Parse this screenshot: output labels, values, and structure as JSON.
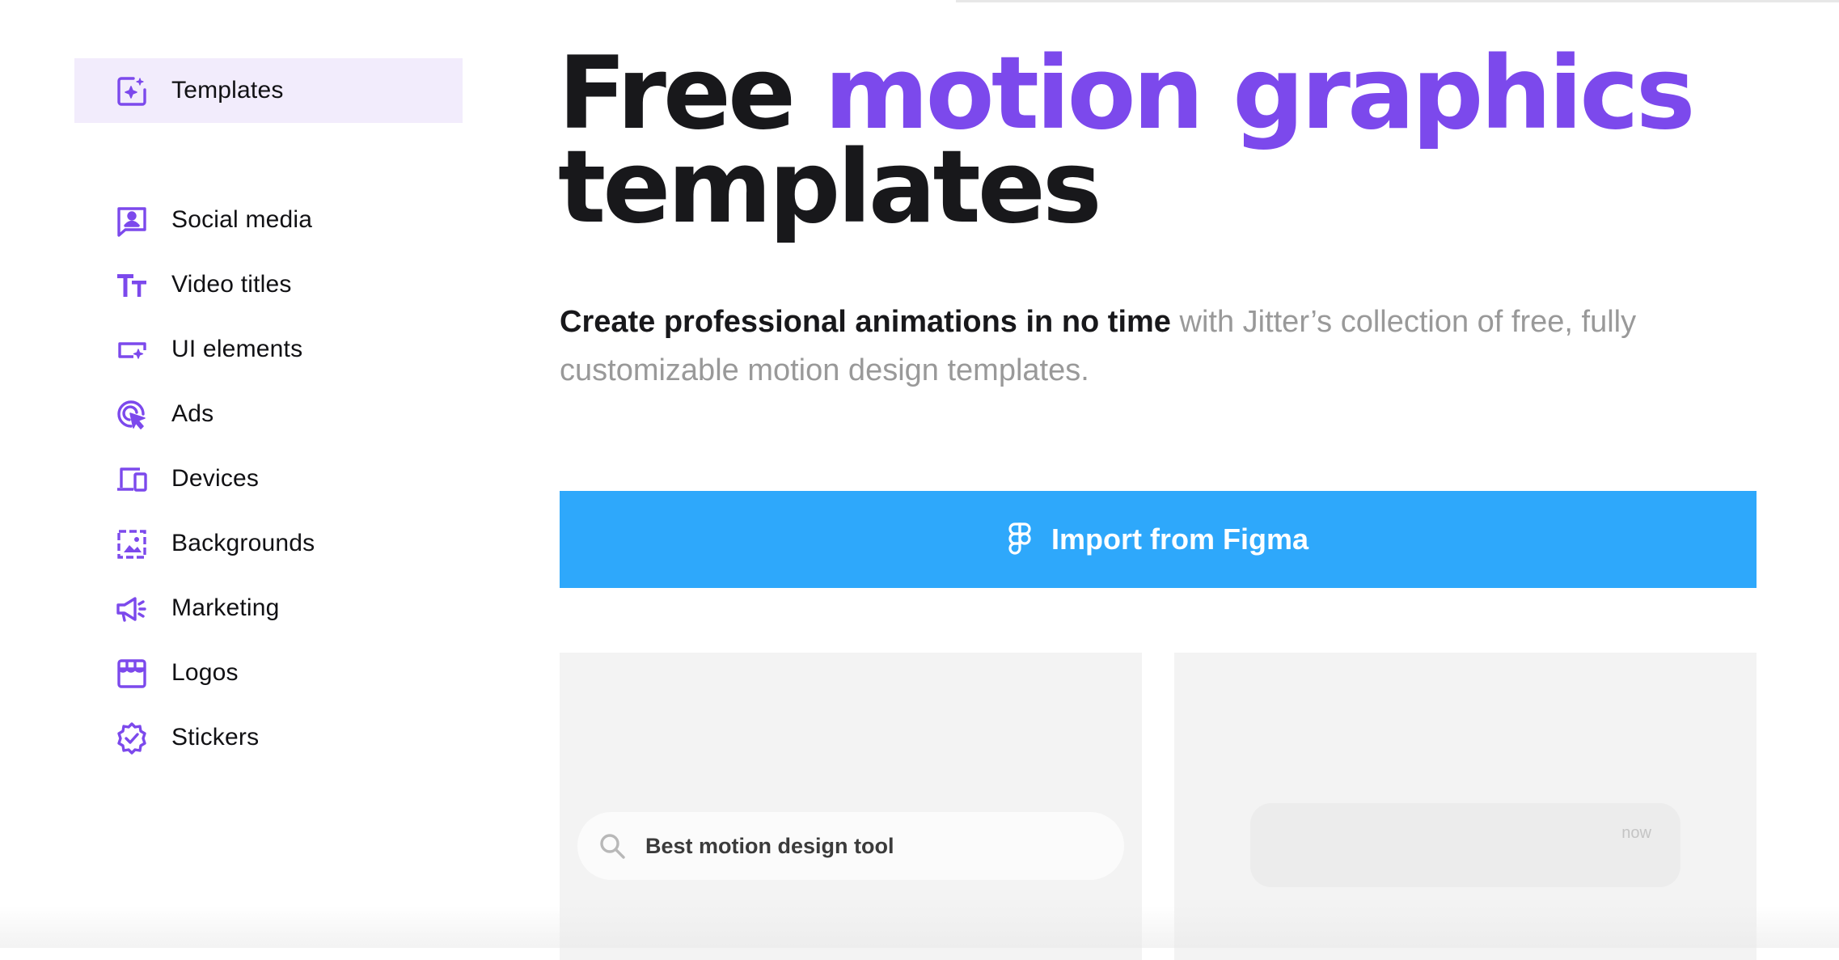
{
  "sidebar": {
    "top_item": {
      "label": "Templates",
      "icon": "sparkle-square-icon"
    },
    "items": [
      {
        "label": "Social media",
        "icon": "chat-user-icon"
      },
      {
        "label": "Video titles",
        "icon": "text-size-icon"
      },
      {
        "label": "UI elements",
        "icon": "ui-button-sparkle-icon"
      },
      {
        "label": "Ads",
        "icon": "target-cursor-icon"
      },
      {
        "label": "Devices",
        "icon": "devices-icon"
      },
      {
        "label": "Backgrounds",
        "icon": "image-frame-icon"
      },
      {
        "label": "Marketing",
        "icon": "megaphone-icon"
      },
      {
        "label": "Logos",
        "icon": "storefront-icon"
      },
      {
        "label": "Stickers",
        "icon": "badge-check-icon"
      }
    ]
  },
  "hero": {
    "title_part1": "Free ",
    "title_accent": "motion graphics",
    "title_part2": "templates",
    "subtitle_strong": "Create professional animations in no time",
    "subtitle_rest": " with Jitter’s collection of free, fully customizable motion design templates."
  },
  "import_button": {
    "label": "Import from Figma",
    "icon": "figma-icon"
  },
  "cards": {
    "left": {
      "search_text": "Best motion design tool",
      "icon": "search-icon"
    },
    "right": {
      "timestamp": "now"
    }
  },
  "colors": {
    "accent": "#7c49ec",
    "active_bg": "#f2ecfc",
    "button": "#2ea8fb",
    "text": "#18181b",
    "muted": "#999999"
  }
}
